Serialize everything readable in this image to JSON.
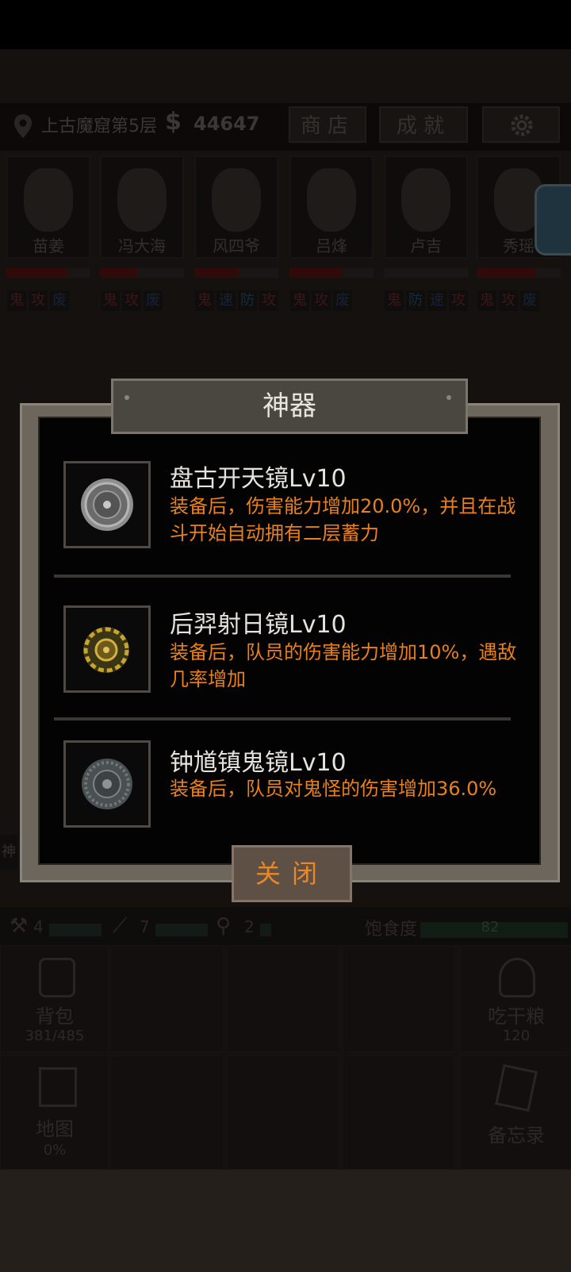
{
  "header": {
    "location": "上古魔窟第5层",
    "money_sign": "$",
    "money": "44647",
    "shop_label": "商店",
    "achievement_label": "成就",
    "settings_icon": "gear-icon"
  },
  "characters": [
    {
      "name": "苗姜",
      "hp": 0.74,
      "tags": [
        "鬼",
        "攻",
        "废"
      ]
    },
    {
      "name": "冯大海",
      "hp": 0.44,
      "tags": [
        "鬼",
        "攻",
        "废"
      ]
    },
    {
      "name": "风四爷",
      "hp": 0.53,
      "tags": [
        "鬼",
        "速",
        "防",
        "攻"
      ]
    },
    {
      "name": "吕烽",
      "hp": 0.63,
      "tags": [
        "鬼",
        "攻",
        "废"
      ]
    },
    {
      "name": "卢吉",
      "hp": 0.0,
      "tags": [
        "鬼",
        "防",
        "速",
        "攻"
      ]
    },
    {
      "name": "秀瑶",
      "hp": 0.7,
      "tags": [
        "鬼",
        "攻",
        "废"
      ]
    }
  ],
  "stats": {
    "tool1_count": "4",
    "tool2_count": "7",
    "tool3_count": "2",
    "hunger_label": "饱食度",
    "hunger_value": "82"
  },
  "grid": {
    "backpack_label": "背包",
    "backpack_count": "381/485",
    "eat_label": "吃干粮",
    "eat_count": "120",
    "map_label": "地图",
    "map_percent": "0%",
    "memo_label": "备忘录",
    "left_edge_text": "神"
  },
  "modal": {
    "title": "神器",
    "items": [
      {
        "name": "盘古开天镜Lv10",
        "desc": "装备后，伤害能力增加20.0%，并且在战斗开始自动拥有二层蓄力"
      },
      {
        "name": "后羿射日镜Lv10",
        "desc": "装备后，队员的伤害能力增加10%，遇敌几率增加"
      },
      {
        "name": "钟馗镇鬼镜Lv10",
        "desc": "装备后，队员对鬼怪的伤害增加36.0%"
      }
    ],
    "close_label": "关闭"
  }
}
